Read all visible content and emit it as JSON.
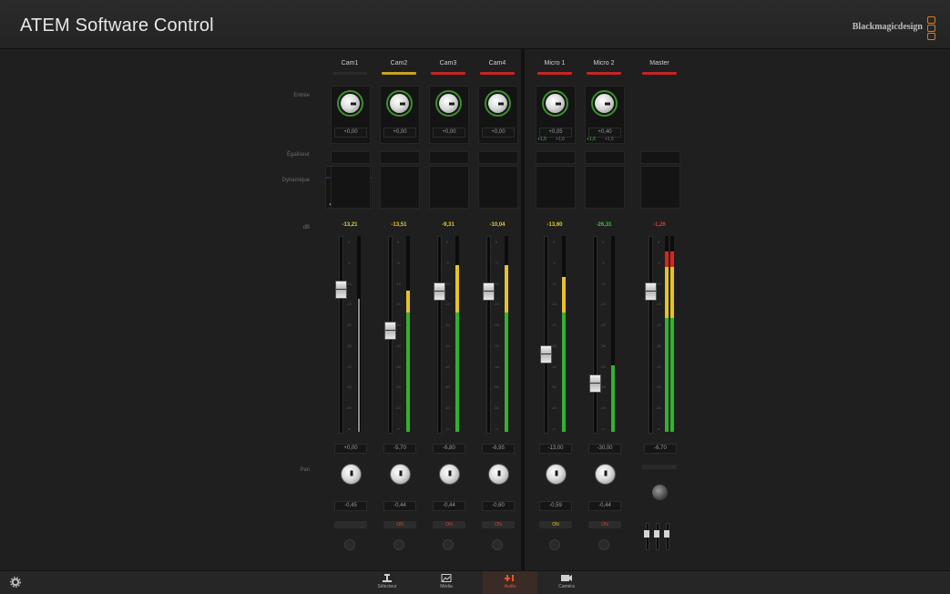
{
  "app": {
    "title": "ATEM Software Control",
    "brand": "Blackmagicdesign"
  },
  "row_labels": {
    "input": "Entrée",
    "equalizer": "Égaliseur",
    "dynamics": "Dynamique",
    "db": "dB",
    "pan": "Pan"
  },
  "channels": [
    {
      "name": "Cam1",
      "tally": "#2b2b2b",
      "gain": "+0,00",
      "level": "-13,21",
      "level_color": "#e3c932",
      "fader_value": "+0,00",
      "pan_value": "-0,45",
      "fader_level": 0.73,
      "meter_green": 0.68,
      "meter_yellow": 0.0,
      "meter_red": 0.0,
      "meter_white": true,
      "action": "",
      "action_color": "#666"
    },
    {
      "name": "Cam2",
      "tally": "#c9a21f",
      "gain": "+0,00",
      "level": "-13,51",
      "level_color": "#e3c932",
      "fader_value": "-5,70",
      "pan_value": "-0,44",
      "fader_level": 0.52,
      "meter_green": 0.61,
      "meter_yellow": 0.11,
      "meter_red": 0.0,
      "meter_white": false,
      "action": "ON",
      "action_color": "#d24a2a"
    },
    {
      "name": "Cam3",
      "tally": "#c52424",
      "gain": "+0,00",
      "level": "-9,31",
      "level_color": "#e3c932",
      "fader_value": "-6,80",
      "pan_value": "-0,44",
      "fader_level": 0.72,
      "meter_green": 0.61,
      "meter_yellow": 0.24,
      "meter_red": 0.0,
      "meter_white": false,
      "action": "ON",
      "action_color": "#d24a2a"
    },
    {
      "name": "Cam4",
      "tally": "#c52424",
      "gain": "+0,00",
      "level": "-10,04",
      "level_color": "#e3c932",
      "fader_value": "-6,95",
      "pan_value": "-0,60",
      "fader_level": 0.72,
      "meter_green": 0.61,
      "meter_yellow": 0.24,
      "meter_red": 0.0,
      "meter_white": false,
      "action": "ON",
      "action_color": "#d24a2a"
    },
    {
      "name": "Micro 1",
      "tally": "#c52424",
      "gain": "+0,05",
      "level": "-13,60",
      "level_color": "#e3c932",
      "fader_value": "-13,00",
      "pan_value": "-0,59",
      "fader_level": 0.4,
      "meter_green": 0.61,
      "meter_yellow": 0.18,
      "meter_red": 0.0,
      "meter_white": false,
      "action": "ON",
      "action_color": "#e3c932"
    },
    {
      "name": "Micro 2",
      "tally": "#c52424",
      "gain": "+0,40",
      "level": "-26,31",
      "level_color": "#42c242",
      "fader_value": "-30,00",
      "pan_value": "-0,44",
      "fader_level": 0.25,
      "meter_green": 0.34,
      "meter_yellow": 0.0,
      "meter_red": 0.0,
      "meter_white": false,
      "action": "ON",
      "action_color": "#d24a2a"
    }
  ],
  "mic_small": [
    {
      "a": "+1,5",
      "b": "+1,6"
    },
    {
      "a": "+1,6",
      "b": "+1,6"
    }
  ],
  "master": {
    "name": "Master",
    "tally": "#c52424",
    "level": "-1,26",
    "level_color": "#d83a3a",
    "fader_value": "-6,70",
    "fader_level": 0.72,
    "meter_green": 0.58,
    "meter_yellow": 0.26,
    "meter_red": 0.08
  },
  "scale_marks": [
    "0",
    "-5",
    "-10",
    "-15",
    "-20",
    "-30",
    "-40",
    "-50",
    "-60",
    "-∞"
  ],
  "nav": [
    {
      "label": "Sélecteur",
      "active": false
    },
    {
      "label": "Média",
      "active": false
    },
    {
      "label": "Audio",
      "active": true
    },
    {
      "label": "Caméra",
      "active": false
    }
  ],
  "colors": {
    "accent": "#e05a2a",
    "meter_green": "#32b22f",
    "meter_yellow": "#e5c22a",
    "meter_red": "#d5261f",
    "knob_ring": "#3e8f2c"
  }
}
